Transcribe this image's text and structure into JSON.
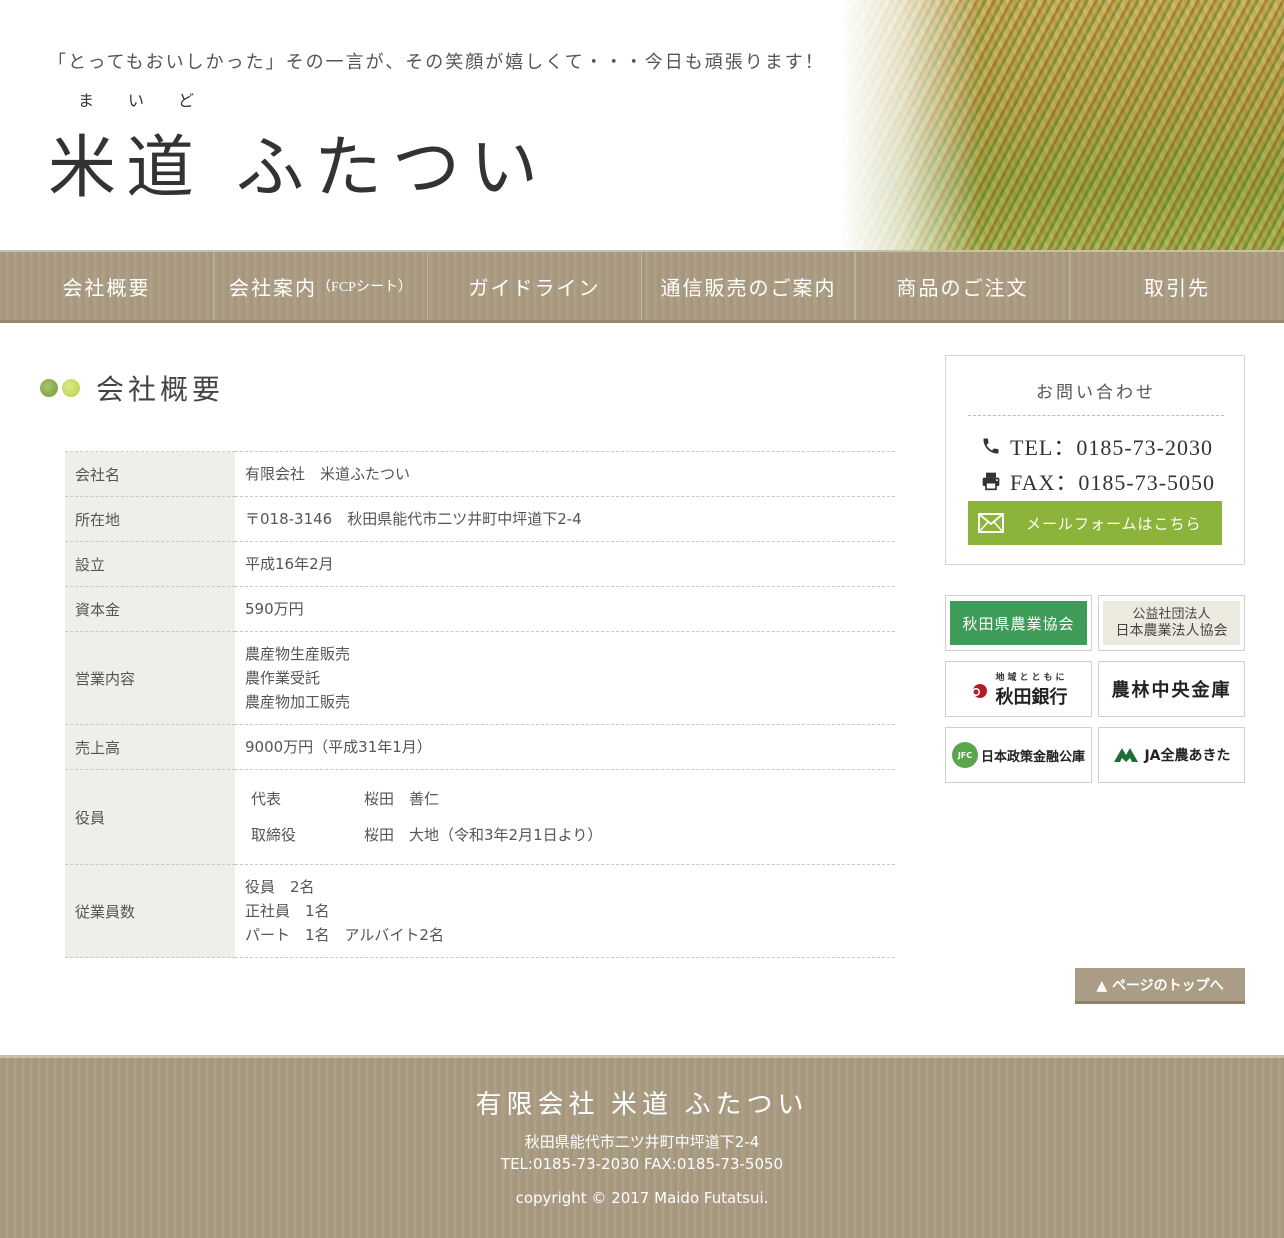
{
  "header": {
    "tagline": "「とってもおいしかった」その一言が、その笑顔が嬉しくて・・・今日も頑張ります！",
    "furigana": "まいど",
    "logo_part1": "米道",
    "logo_part2": "ふたつい"
  },
  "nav": {
    "items": [
      {
        "label": "会社概要"
      },
      {
        "label": "会社案内",
        "sub": "（FCPシート）"
      },
      {
        "label": "ガイドライン"
      },
      {
        "label": "通信販売のご案内"
      },
      {
        "label": "商品のご注文"
      },
      {
        "label": "取引先"
      }
    ]
  },
  "main": {
    "title": "会社概要",
    "table": {
      "company_name_label": "会社名",
      "company_name": "有限会社　米道ふたつい",
      "address_label": "所在地",
      "address": "〒018-3146　秋田県能代市二ツ井町中坪道下2-4",
      "founded_label": "設立",
      "founded": "平成16年2月",
      "capital_label": "資本金",
      "capital": "590万円",
      "business_label": "営業内容",
      "business": [
        "農産物生産販売",
        "農作業受託",
        "農産物加工販売"
      ],
      "sales_label": "売上高",
      "sales": "9000万円（平成31年1月）",
      "officers_label": "役員",
      "officers": [
        {
          "role": "代表",
          "name": "桜田　善仁"
        },
        {
          "role": "取締役",
          "name": "桜田　大地（令和3年2月1日より）"
        }
      ],
      "employees_label": "従業員数",
      "employees": [
        "役員　2名",
        "正社員　1名",
        "パート　1名　アルバイト2名"
      ]
    }
  },
  "sidebar": {
    "contact_title": "お問い合わせ",
    "tel": "TEL：0185-73-2030",
    "fax": "FAX：0185-73-5050",
    "mail_button": "メールフォームはこちら",
    "banners": {
      "b1": "秋田県農業協会",
      "b2_line1": "公益社団法人",
      "b2_line2": "日本農業法人協会",
      "b3_sub": "地域とともに",
      "b3_main": "秋田銀行",
      "b4": "農林中央金庫",
      "b5_mark": "JFC",
      "b5": "日本政策金融公庫",
      "b6": "JA全農あきた"
    }
  },
  "to_top": "▲ ページのトップへ",
  "footer": {
    "name": "有限会社 米道 ふたつい",
    "address": "秋田県能代市二ツ井町中坪道下2-4",
    "contact": "TEL:0185-73-2030 FAX:0185-73-5050",
    "copyright": "copyright © 2017 Maido Futatsui."
  },
  "colors": {
    "nav_bg": "#aa9c83",
    "accent_green": "#8db43a",
    "banner_green": "#3e9b58",
    "table_header_bg": "#efeeea"
  }
}
